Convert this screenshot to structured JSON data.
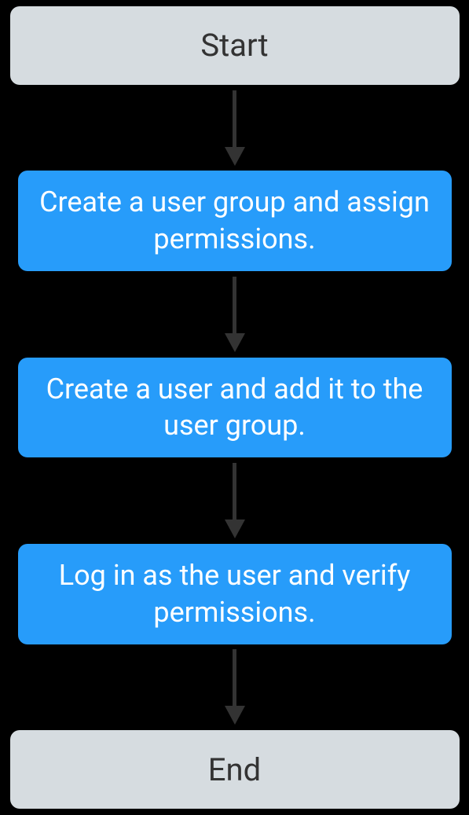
{
  "flowchart": {
    "start": "Start",
    "step1": "Create a user group and assign permissions.",
    "step2": "Create a user and add it to the user group.",
    "step3": "Log in as the user and verify permissions.",
    "end": "End"
  }
}
